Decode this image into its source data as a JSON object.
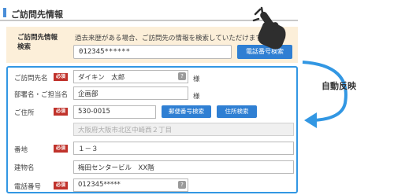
{
  "header": {
    "title": "ご訪問先情報"
  },
  "search": {
    "label": "ご訪問先情報\n検索",
    "note": "過去来歴がある場合、ご訪問先の情報を検索していただけます。",
    "value": "012345******",
    "button_label": "電話番号検索"
  },
  "auto_reflect": {
    "label": "自動反映"
  },
  "form": {
    "required_badge": "必須",
    "help_badge": "?",
    "rows": [
      {
        "label": "ご訪問先名",
        "value": "ダイキン　太郎",
        "suffix": "様"
      },
      {
        "label": "部署名・ご担当名",
        "value": "企画部",
        "suffix": "様"
      },
      {
        "label": "ご住所",
        "postal_value": "530-0015",
        "postal_button": "郵便番号検索",
        "address_button": "住所検索",
        "address_readonly": "大阪府大阪市北区中崎西２丁目"
      },
      {
        "label": "番地",
        "value": "１－３"
      },
      {
        "label": "建物名",
        "value": "梅田センタービル　XX階"
      },
      {
        "label": "電話番号",
        "value": "012345*****"
      }
    ]
  },
  "colors": {
    "accent_blue": "#2f7fd3",
    "required_red": "#c0322b",
    "search_bg": "#fcefd9",
    "frame_blue": "#3297e3"
  }
}
